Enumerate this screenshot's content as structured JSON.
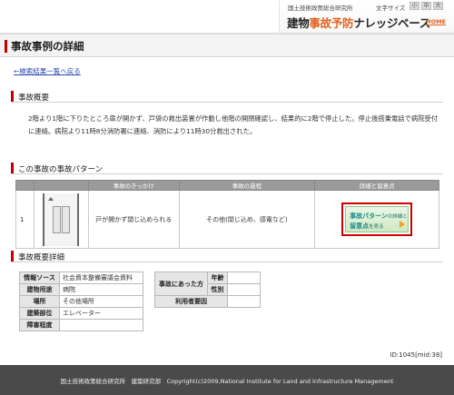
{
  "header": {
    "org_name": "国土技術政策総合研究所",
    "text_size_label": "文字サイズ",
    "size_buttons": [
      "小",
      "中",
      "大"
    ],
    "brand_prefix": "建物",
    "brand_accent": "事故予防",
    "brand_suffix": "ナレッジベース",
    "home_label": "HOME"
  },
  "page": {
    "title": "事故事例の詳細",
    "back_link": "←検索結果一覧へ戻る"
  },
  "sections": {
    "summary": "事故概要",
    "pattern": "この事故の事故パターン",
    "detail": "事故概要詳細"
  },
  "summary_text": "2階より1階に下りたところ扉が開かず、戸袋の救出装置が作動し他階の開閉確認し、結果的に2階で停止した。停止後搭乗電話で病院受付に連絡。病院より11時8分消防署に連絡、消防により11時30分救出された。",
  "pattern_table": {
    "headers": [
      "事故のきっかけ",
      "事故の過程",
      "詳細と留意点"
    ],
    "rows": [
      {
        "num": "1",
        "trigger": "戸が開かず閉じ込められる",
        "process": "その他(閉じ込め、感電など)",
        "button_main1": "事故パターン",
        "button_small1": "の詳細と",
        "button_main2": "留意点",
        "button_small2": "を見る"
      }
    ]
  },
  "detail_left": {
    "rows": [
      {
        "label": "情報ソース",
        "value": "社会資本整備審議会資料"
      },
      {
        "label": "建物用途",
        "value": "病院"
      },
      {
        "label": "場所",
        "value": "その他場所"
      },
      {
        "label": "建築部位",
        "value": "エレベーター"
      },
      {
        "label": "障害程度",
        "value": ""
      }
    ]
  },
  "detail_right": {
    "group_label": "事故にあった方",
    "rows": [
      {
        "label": "年齢",
        "value": ""
      },
      {
        "label": "性別",
        "value": ""
      }
    ],
    "cause_label": "利用者要因",
    "cause_value": ""
  },
  "record_id": "ID:1045[mid:38]",
  "footer": {
    "text": "国土技術政策総合研究所　建築研究部　Copyright(c)2009,National Institute for Land and Infrastructure Management"
  },
  "colors": {
    "accent_red": "#c00000",
    "brand_orange": "#e0601a",
    "footer_bg": "#4a4a4a"
  }
}
